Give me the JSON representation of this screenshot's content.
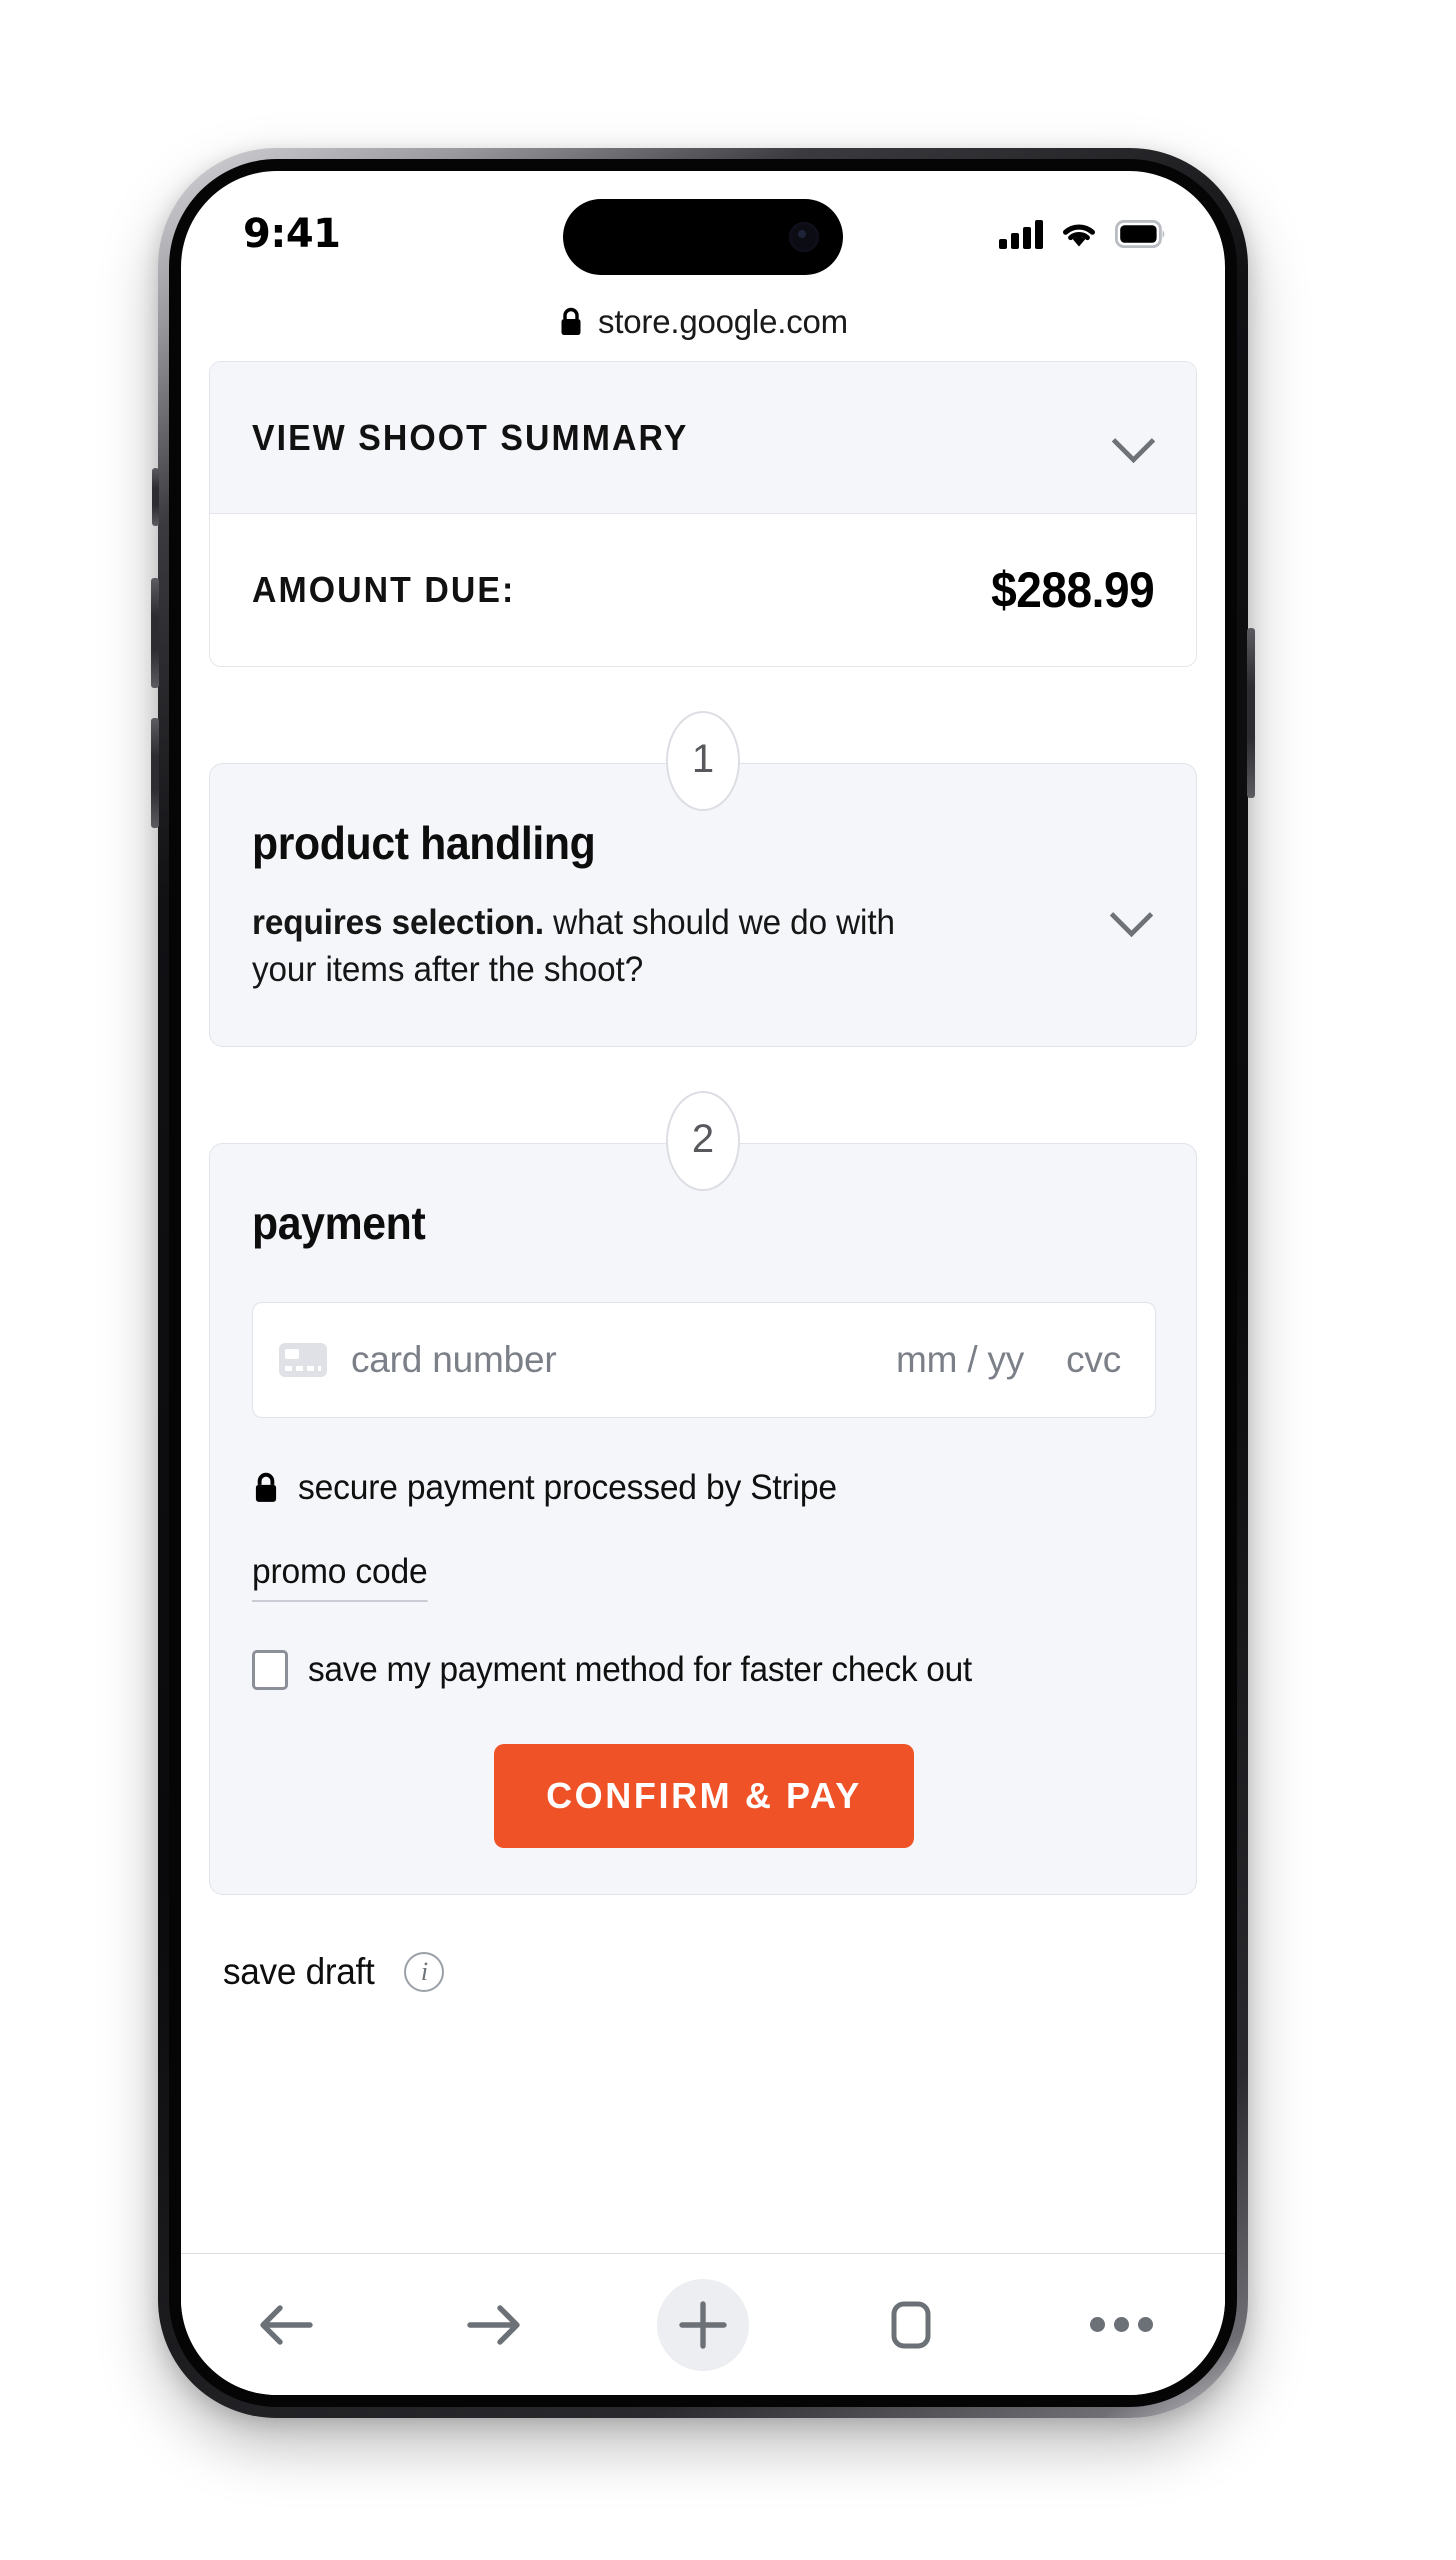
{
  "status_bar": {
    "time": "9:41",
    "signal_icon": "cellular-signal-icon",
    "wifi_icon": "wifi-icon",
    "battery_icon": "battery-full-icon"
  },
  "browser": {
    "url": "store.google.com",
    "lock_icon": "lock-icon",
    "toolbar": {
      "back": "back-arrow-icon",
      "forward": "forward-arrow-icon",
      "add": "plus-icon",
      "tabs": "tabs-square-icon",
      "more": "more-dots-icon"
    }
  },
  "summary": {
    "view_shoot_summary_label": "VIEW SHOOT SUMMARY",
    "amount_due_label": "AMOUNT DUE:",
    "amount_due_value": "$288.99"
  },
  "steps": [
    {
      "number": "1",
      "title": "product handling",
      "desc_bold": "requires selection.",
      "desc_rest": " what should we do with your items after the shoot?"
    },
    {
      "number": "2",
      "title": "payment"
    }
  ],
  "payment": {
    "card_number_placeholder": "card number",
    "expiry_placeholder": "mm / yy",
    "cvc_placeholder": "cvc",
    "secure_note": "secure payment processed by Stripe",
    "promo_code_label": "promo code",
    "save_method_label": "save my payment method for faster check out",
    "save_method_checked": false,
    "confirm_button_label": "CONFIRM & PAY",
    "save_draft_label": "save draft",
    "accent_color": "#ef5226"
  }
}
